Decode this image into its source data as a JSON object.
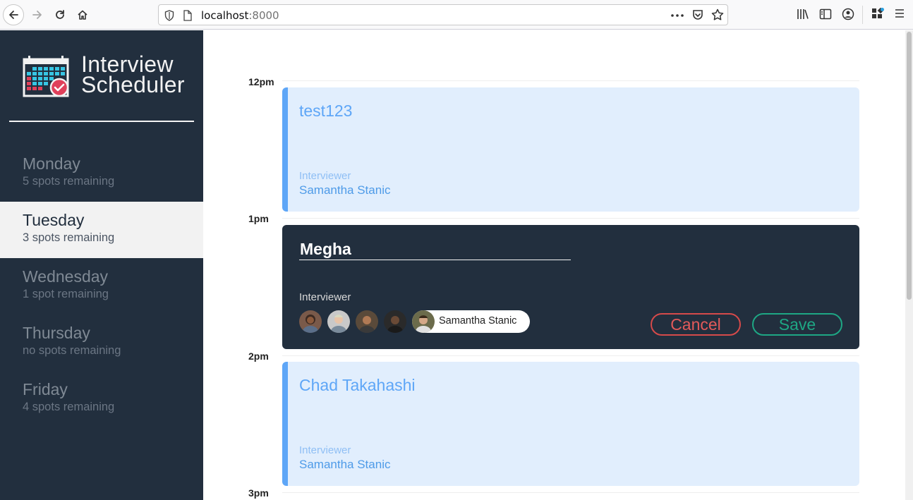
{
  "browser": {
    "url_host": "localhost",
    "url_port": ":8000"
  },
  "sidebar": {
    "brand_line1": "Interview",
    "brand_line2": "Scheduler",
    "days": [
      {
        "name": "Monday",
        "spots": "5 spots remaining",
        "selected": false
      },
      {
        "name": "Tuesday",
        "spots": "3 spots remaining",
        "selected": true
      },
      {
        "name": "Wednesday",
        "spots": "1 spot remaining",
        "selected": false
      },
      {
        "name": "Thursday",
        "spots": "no spots remaining",
        "selected": false
      },
      {
        "name": "Friday",
        "spots": "4 spots remaining",
        "selected": false
      }
    ]
  },
  "schedule": {
    "times": [
      "12pm",
      "1pm",
      "2pm",
      "3pm"
    ],
    "appointments": [
      {
        "student": "test123",
        "interviewer_label": "Interviewer",
        "interviewer": "Samantha Stanic"
      },
      {
        "student": "Chad Takahashi",
        "interviewer_label": "Interviewer",
        "interviewer": "Samantha Stanic"
      }
    ],
    "form": {
      "student_value": "Megha",
      "interviewer_label": "Interviewer",
      "selected_interviewer": "Samantha Stanic",
      "cancel_label": "Cancel",
      "save_label": "Save"
    }
  },
  "colors": {
    "sidebar_bg": "#222f3e",
    "appointment_bg": "#e1eefd",
    "appointment_accent": "#5ea6f7",
    "cancel": "#d64a4a",
    "save": "#1ea784"
  }
}
